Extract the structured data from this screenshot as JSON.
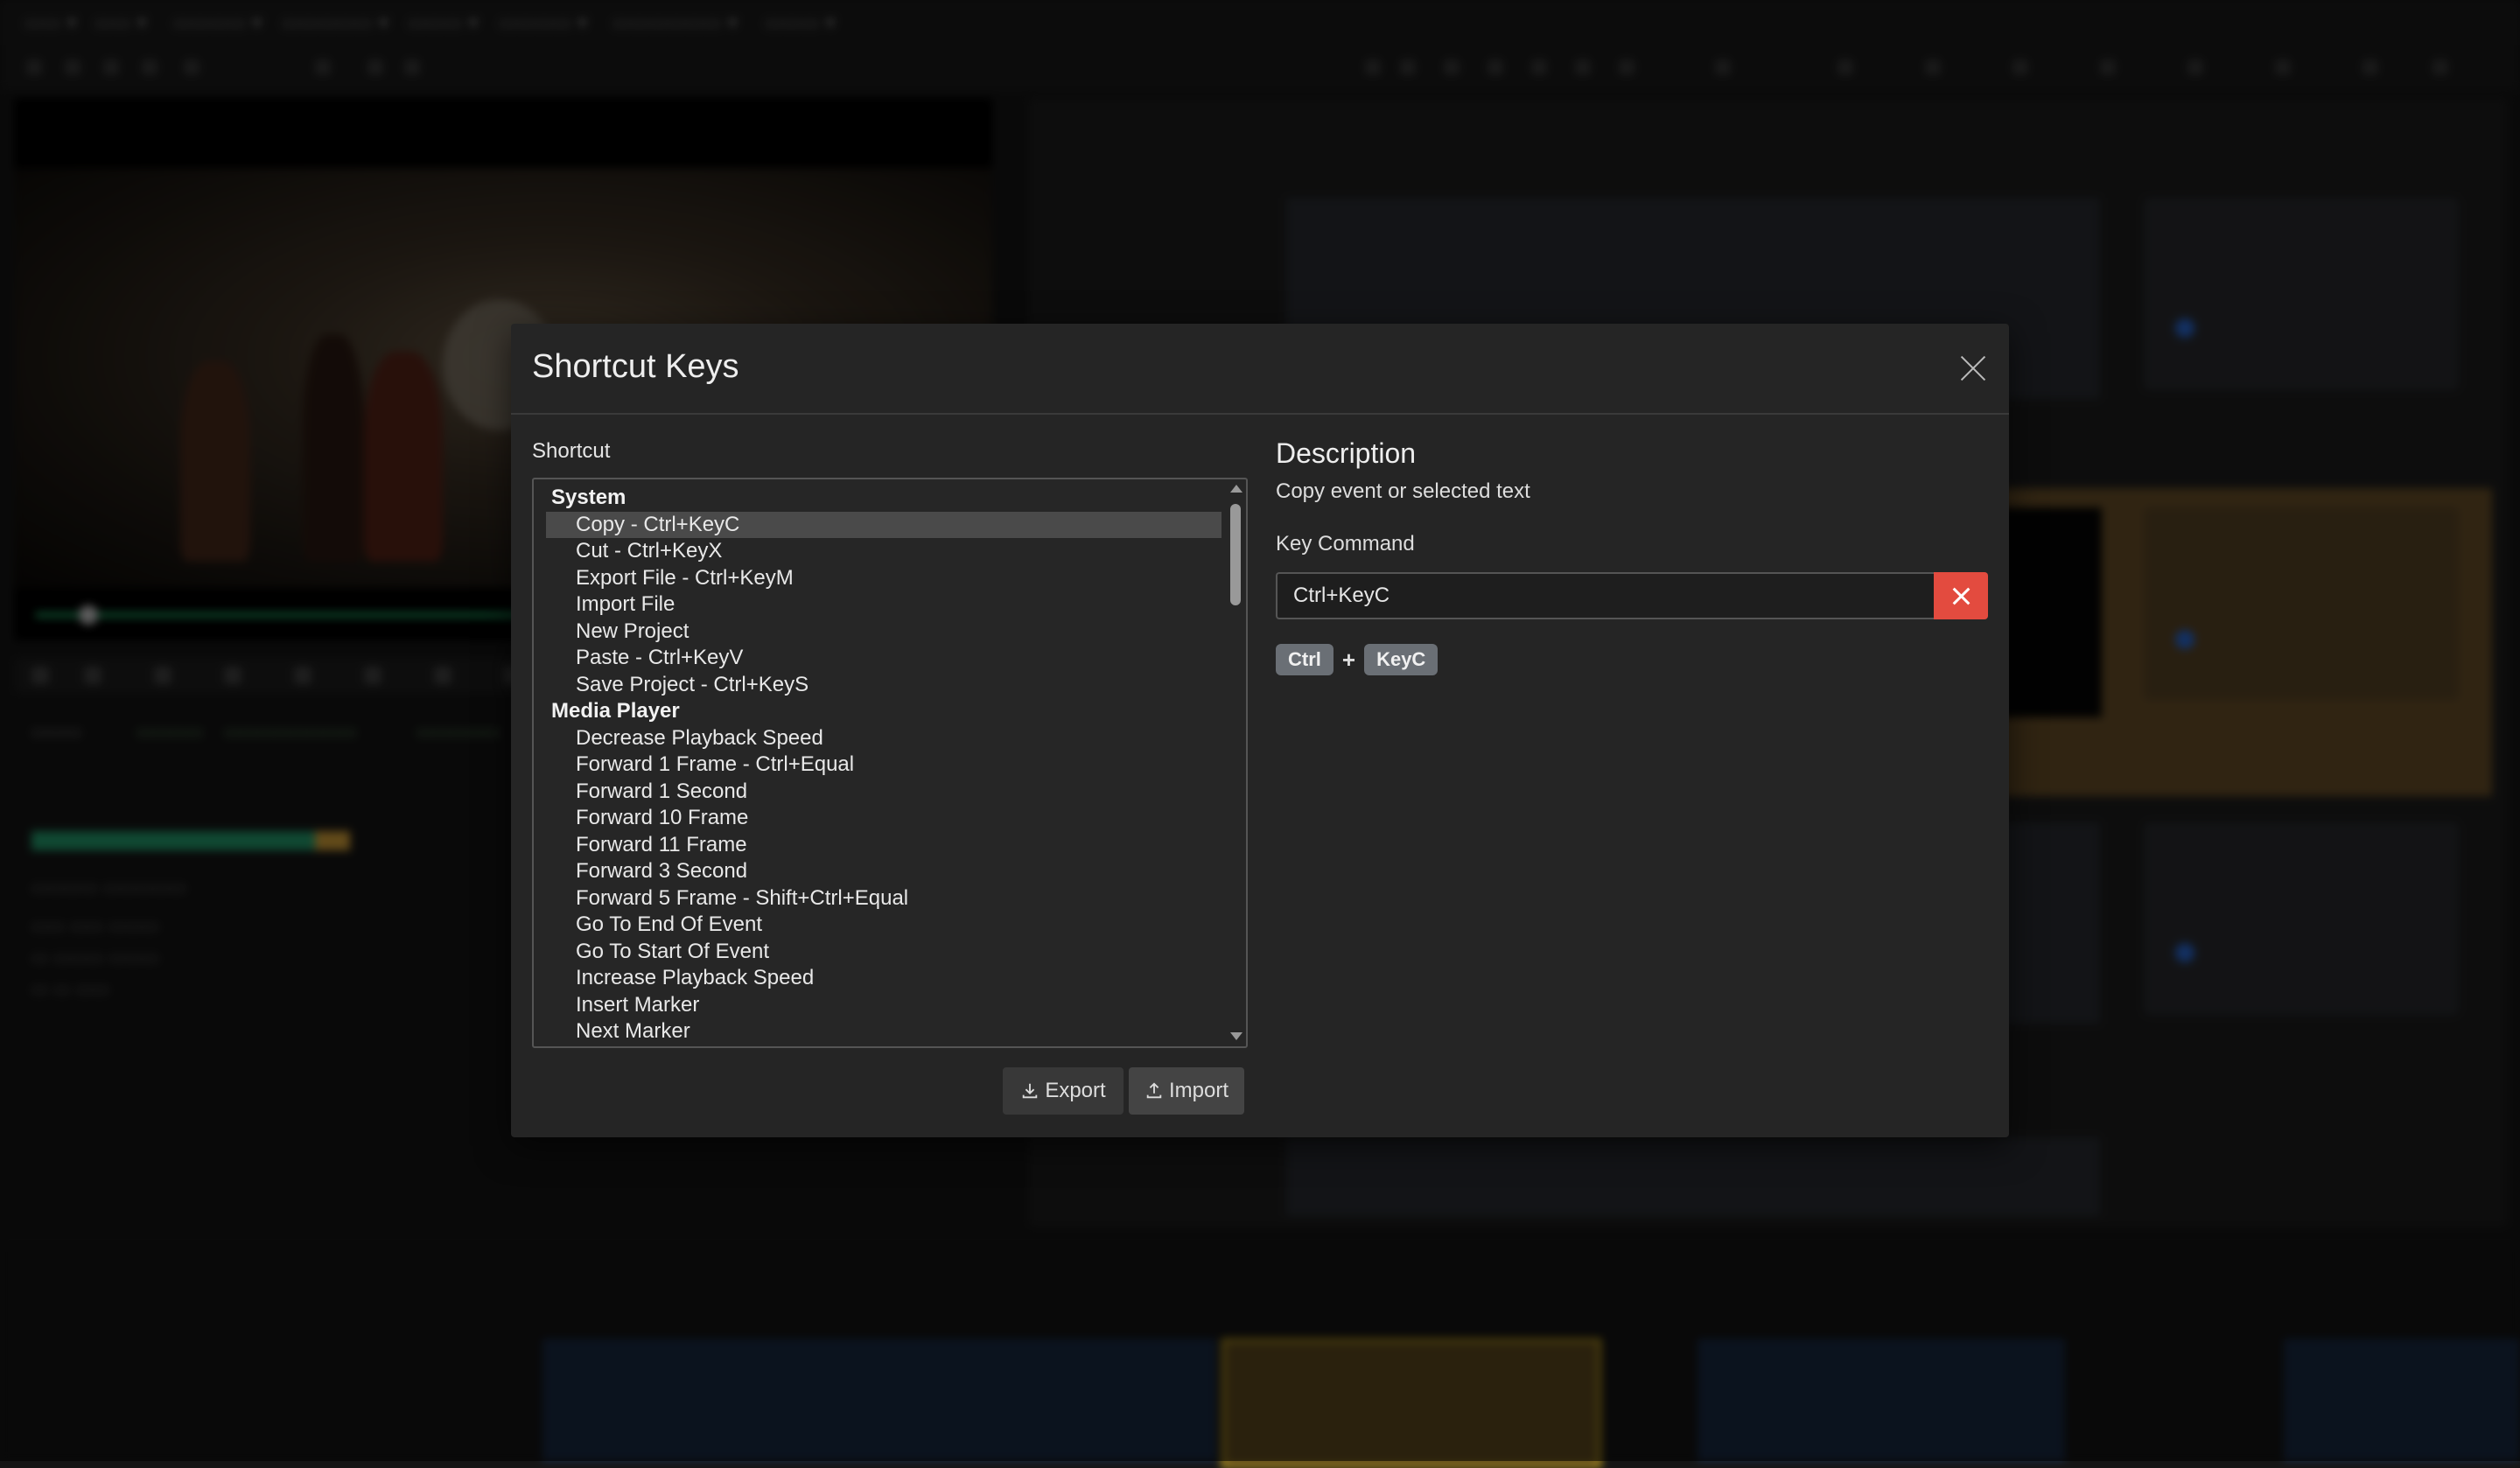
{
  "modal": {
    "title": "Shortcut Keys",
    "shortcut_label": "Shortcut",
    "groups": [
      {
        "name": "System",
        "items": [
          "Copy - Ctrl+KeyC",
          "Cut - Ctrl+KeyX",
          "Export File - Ctrl+KeyM",
          "Import File",
          "New Project",
          "Paste - Ctrl+KeyV",
          "Save Project - Ctrl+KeyS"
        ]
      },
      {
        "name": "Media Player",
        "items": [
          "Decrease Playback Speed",
          "Forward 1 Frame - Ctrl+Equal",
          "Forward 1 Second",
          "Forward 10 Frame",
          "Forward 11 Frame",
          "Forward 3 Second",
          "Forward 5 Frame - Shift+Ctrl+Equal",
          "Go To End Of Event",
          "Go To Start Of Event",
          "Increase Playback Speed",
          "Insert Marker",
          "Next Marker"
        ]
      }
    ],
    "selected": "Copy - Ctrl+KeyC",
    "description_title": "Description",
    "description_text": "Copy event or selected text",
    "key_command_label": "Key Command",
    "key_command_value": "Ctrl+KeyC",
    "keys": [
      "Ctrl",
      "KeyC"
    ],
    "plus": "+",
    "export_label": "Export",
    "import_label": "Import"
  },
  "colors": {
    "clear_button": "#e34b3f",
    "selected_row": "#4a4a4a",
    "key_chip": "#6a6f75"
  }
}
